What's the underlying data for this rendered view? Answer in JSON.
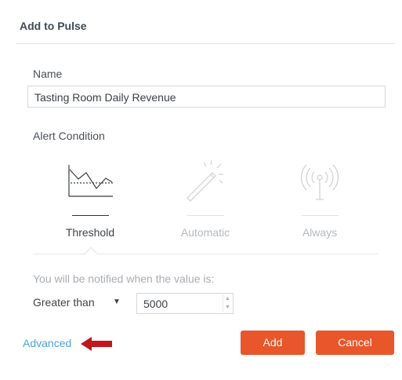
{
  "dialog": {
    "title": "Add to Pulse"
  },
  "name_field": {
    "label": "Name",
    "value": "Tasting Room Daily Revenue"
  },
  "alert_condition": {
    "label": "Alert Condition",
    "options": [
      {
        "label": "Threshold",
        "icon": "threshold-chart-icon",
        "selected": true
      },
      {
        "label": "Automatic",
        "icon": "magic-wand-icon",
        "selected": false
      },
      {
        "label": "Always",
        "icon": "broadcast-antenna-icon",
        "selected": false
      }
    ]
  },
  "notify": {
    "text": "You will be notified when the value is:",
    "operator": "Greater than",
    "value": "5000"
  },
  "footer": {
    "advanced_link": "Advanced",
    "add_label": "Add",
    "cancel_label": "Cancel"
  },
  "colors": {
    "accent": "#e8562a",
    "link": "#4aa3df",
    "annotation_arrow": "#c0161c"
  }
}
